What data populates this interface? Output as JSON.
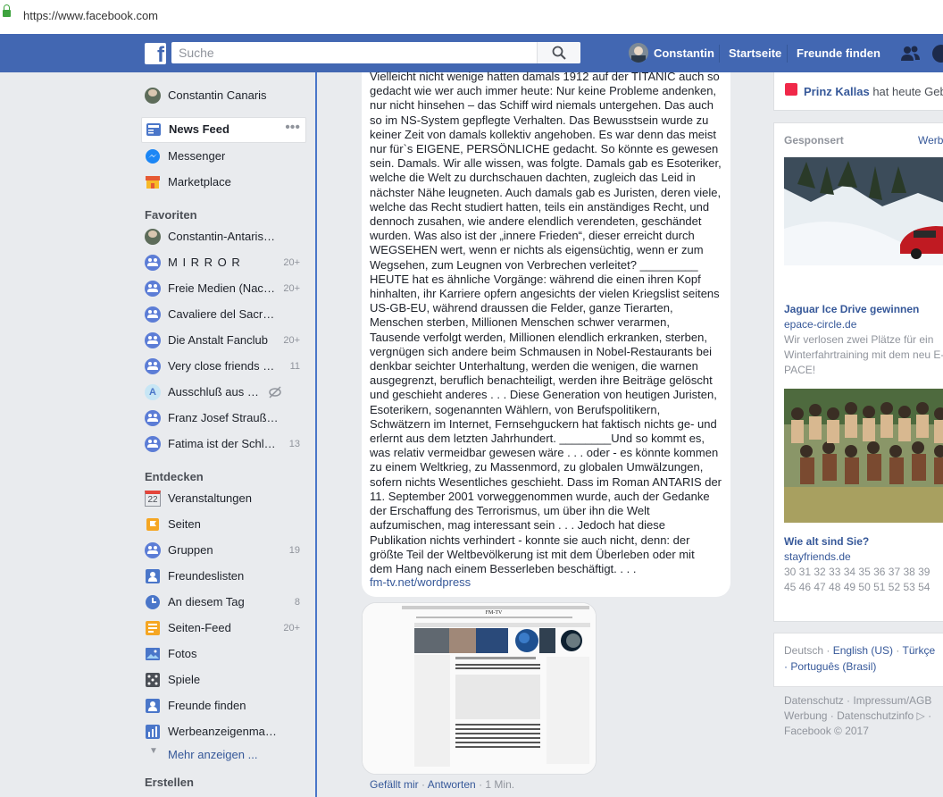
{
  "browser": {
    "url": "https://www.facebook.com"
  },
  "topnav": {
    "search_placeholder": "Suche",
    "user_name": "Constantin",
    "home_label": "Startseite",
    "find_friends_label": "Freunde finden"
  },
  "sidebar": {
    "profile_name": "Constantin Canaris",
    "main_items": [
      {
        "label": "News Feed",
        "icon": "news-feed-icon"
      },
      {
        "label": "Messenger",
        "icon": "messenger-icon"
      },
      {
        "label": "Marketplace",
        "icon": "marketplace-icon"
      }
    ],
    "favorites_title": "Favoriten",
    "favorites": [
      {
        "label": "Constantin-Antaris…",
        "count": ""
      },
      {
        "label": "M I R R O R",
        "count": "20+"
      },
      {
        "label": "Freie Medien (Nach…",
        "count": "20+"
      },
      {
        "label": "Cavaliere del Sacro…",
        "count": ""
      },
      {
        "label": "Die Anstalt Fanclub",
        "count": "20+"
      },
      {
        "label": "Very close friends …",
        "count": "11"
      },
      {
        "label": "Ausschluß aus …",
        "count": ""
      },
      {
        "label": "Franz Josef Strauß …",
        "count": ""
      },
      {
        "label": "Fatima ist der Schl…",
        "count": "13"
      }
    ],
    "explore_title": "Entdecken",
    "calendar_day": "22",
    "explore": [
      {
        "label": "Veranstaltungen",
        "count": ""
      },
      {
        "label": "Seiten",
        "count": ""
      },
      {
        "label": "Gruppen",
        "count": "19"
      },
      {
        "label": "Freundeslisten",
        "count": ""
      },
      {
        "label": "An diesem Tag",
        "count": "8"
      },
      {
        "label": "Seiten-Feed",
        "count": "20+"
      },
      {
        "label": "Fotos",
        "count": ""
      },
      {
        "label": "Spiele",
        "count": ""
      },
      {
        "label": "Freunde finden",
        "count": ""
      },
      {
        "label": "Werbeanzeigenma…",
        "count": ""
      }
    ],
    "more_label": "Mehr anzeigen ...",
    "create_title": "Erstellen"
  },
  "post": {
    "text": "Vielleicht nicht wenige hatten damals 1912 auf der TITANIC auch so\ngedacht wie wer auch immer heute: Nur keine Probleme andenken,\nnur nicht hinsehen – das Schiff wird niemals untergehen. Das auch\nso im NS-System gepflegte Verhalten. Das Bewusstsein wurde zu\nkeiner Zeit von damals kollektiv angehoben. Es war denn das meist\nnur für`s EIGENE, PERSÖNLICHE gedacht. So könnte es gewesen\nsein. Damals. Wir alle wissen, was folgte. Damals gab es Esoteriker,\nwelche die Welt zu durchschauen dachten, zugleich das Leid in\nnächster Nähe leugneten. Auch damals gab es Juristen, deren viele,\nwelche das Recht studiert hatten, teils ein anständiges Recht, und\ndennoch zusahen, wie andere elendlich verendeten, geschändet\nwurden. Was also ist der „innere Frieden“, dieser erreicht durch\nWEGSEHEN wert, wenn er nichts als eigensüchtig, wenn er zum\nWegsehen, zum Leugnen von Verbrechen verleitet? _________\nHEUTE hat es ähnliche Vorgänge: während die einen ihren Kopf\nhinhalten, ihr Karriere opfern angesichts der vielen Kriegslist seitens\nUS-GB-EU, während draussen die Felder, ganze Tierarten,\nMenschen sterben, Millionen Menschen schwer verarmen,\nTausende verfolgt werden, Millionen elendlich erkranken, sterben,\nvergnügen sich andere beim Schmausen in Nobel-Restaurants bei\ndenkbar seichter Unterhaltung, werden die wenigen, die warnen\nausgegrenzt, beruflich benachteiligt, werden ihre Beiträge gelöscht\nund geschieht anderes . . . Diese Generation von heutigen Juristen,\nEsoterikern, sogenannten Wählern, von Berufspolitikern,\nSchwätzern im Internet, Fernsehguckern hat faktisch nichts ge- und\nerlernt aus dem letzten Jahrhundert. ________Und so kommt es,\nwas relativ vermeidbar gewesen wäre . . . oder - es könnte kommen\nzu einem Weltkrieg, zu Massenmord, zu globalen Umwälzungen,\nsofern nichts Wesentliches geschieht. Dass im Roman ANTARIS der\n11. September 2001 vorweggenommen wurde, auch der Gedanke\nder Erschaffung des Terrorismus, um über ihn die Welt\naufzumischen, mag interessant sein . . . Jedoch hat diese\nPublikation nichts verhindert - konnte sie auch nicht, denn: der\ngrößte Teil der Weltbevölkerung ist mit dem Überleben oder mit\ndem Hang nach einem Besserleben beschäftigt. . . .",
    "link": "fm-tv.net/wordpress",
    "thumb_title": "FM-TV",
    "like_label": "Gefällt mir",
    "reply_label": "Antworten",
    "sep": " · ",
    "time": "1 Min."
  },
  "right": {
    "birthday_name": "Prinz Kallas",
    "birthday_text": " hat heute Geb",
    "sponsored_label": "Gesponsert",
    "create_ad_label": "Werb",
    "ad1_title": "Jaguar Ice Drive gewinnen",
    "ad1_domain": "epace-circle.de",
    "ad1_desc": "Wir verlosen zwei Plätze für ein Winterfahrtraining mit dem neu E-PACE!",
    "ad2_title": "Wie alt sind Sie?",
    "ad2_domain": "stayfriends.de",
    "ad2_numbers_1": "30 31 32 33 34 35 36 37 38 39",
    "ad2_numbers_2": "45 46 47 48 49 50 51 52 53 54",
    "lang_current": "Deutsch · ",
    "lang_en": "English (US)",
    "lang_sep": " · ",
    "lang_tr": "Türkçe",
    "lang_pt_prefix": "· ",
    "lang_pt": "Português (Brasil)",
    "footer_1": "Datenschutz · Impressum/AGB",
    "footer_2": "Werbung · Datenschutzinfo ▷ ·",
    "footer_3": "Facebook © 2017"
  },
  "colors": {
    "brand": "#4267b2",
    "link": "#365899",
    "background": "#e9ebee"
  }
}
